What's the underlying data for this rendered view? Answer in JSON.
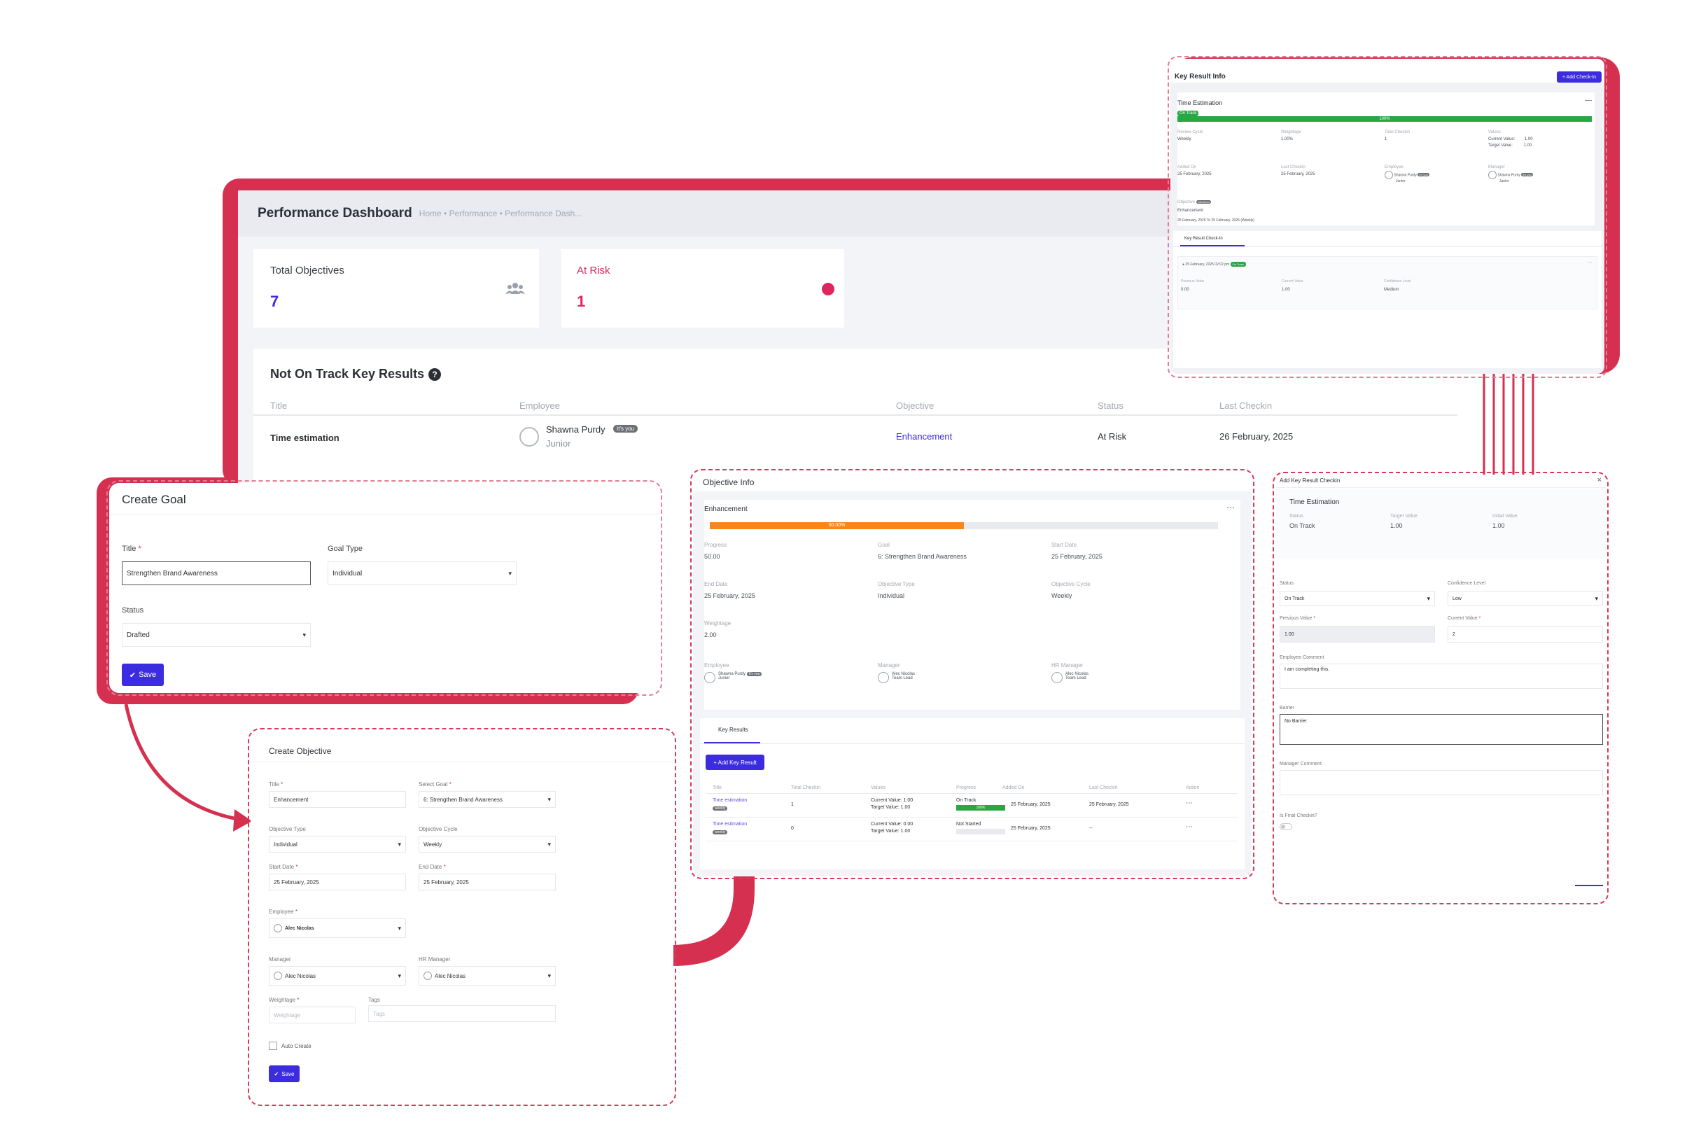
{
  "dashboard": {
    "title": "Performance Dashboard",
    "breadcrumb": "Home • Performance • Performance Dash...",
    "stats": [
      {
        "label": "Total Objectives",
        "value": "7",
        "icon": "users-icon"
      },
      {
        "label": "At Risk",
        "value": "1",
        "icon": "red-dot-icon"
      }
    ],
    "not_on_track": {
      "heading": "Not On Track Key Results",
      "columns": [
        "Title",
        "Employee",
        "Objective",
        "Status",
        "Last Checkin"
      ],
      "row": {
        "title": "Time estimation",
        "employee": "Shawna Purdy",
        "employee_badge": "It's you",
        "employee_role": "Junior",
        "objective": "Enhancement",
        "status": "At Risk",
        "last_checkin": "26 February, 2025"
      }
    }
  },
  "key_result_info": {
    "title": "Key Result Info",
    "add_checkin": "+ Add Check-In",
    "name": "Time Estimation",
    "badge": "On Track",
    "progress_label": "100%",
    "progress": 1.0,
    "fields": [
      {
        "label": "Review Cycle",
        "value": "Weekly"
      },
      {
        "label": "Weightage",
        "value": "1.00%"
      },
      {
        "label": "Total Checkin",
        "value": "1"
      },
      {
        "label": "Values",
        "value": ""
      }
    ],
    "current_value_label": "Current Value:",
    "current_value": "1.00",
    "target_value_label": "Target Value:",
    "target_value": "1.00",
    "fields2": [
      {
        "label": "Added On",
        "value": "25 February, 2025"
      },
      {
        "label": "Last Checkin",
        "value": "25 February, 2025"
      },
      {
        "label": "Employee",
        "value": "Shawna Purdy",
        "badge": "It's you",
        "role": "Junior"
      },
      {
        "label": "Manager",
        "value": "Shawna Purdy",
        "badge": "It's you",
        "role": "Junior"
      }
    ],
    "objective_label": "Objective",
    "objective_badge": "Individual",
    "objective_value": "Enhancement",
    "objective_dates": "25 February, 2025 To 25 February, 2025 (Weekly)",
    "tab": "Key Result Check-In",
    "checkin_time": "25 February, 2025 02:02 pm",
    "checkin_badge": "On Track",
    "checkin_fields": [
      {
        "label": "Previous Value",
        "value": "0.00"
      },
      {
        "label": "Current Value",
        "value": "1.00"
      },
      {
        "label": "Confidence Level",
        "value": "Medium"
      }
    ]
  },
  "create_goal": {
    "title": "Create Goal",
    "title_label": "Title",
    "title_value": "Strengthen Brand Awareness",
    "goal_type_label": "Goal Type",
    "goal_type_value": "Individual",
    "status_label": "Status",
    "status_value": "Drafted",
    "save": "Save"
  },
  "create_objective": {
    "title": "Create Objective",
    "fields": {
      "title_label": "Title",
      "title_value": "Enhancement",
      "goal_label": "Select Goal",
      "goal_value": "6: Strengthen Brand Awareness",
      "type_label": "Objective Type",
      "type_value": "Individual",
      "cycle_label": "Objective Cycle",
      "cycle_value": "Weekly",
      "start_label": "Start Date",
      "start_value": "25 February, 2025",
      "end_label": "End Date",
      "end_value": "25 February, 2025",
      "employee_label": "Employee",
      "employee_value": "Alec Nicolas",
      "manager_label": "Manager",
      "manager_value": "Alec Nicolas",
      "hr_label": "HR Manager",
      "hr_value": "Alec Nicolas",
      "weightage_label": "Weightage",
      "weightage_placeholder": "Weightage",
      "tags_label": "Tags",
      "tags_placeholder": "Tags",
      "auto_create": "Auto Create"
    },
    "save": "Save"
  },
  "objective_info": {
    "title": "Objective Info",
    "name": "Enhancement",
    "progress_label": "50.00%",
    "progress": 0.5,
    "fields": [
      {
        "label": "Progress",
        "value": "50.00"
      },
      {
        "label": "Goal",
        "value": "6: Strengthen Brand Awareness"
      },
      {
        "label": "Start Date",
        "value": "25 February, 2025"
      },
      {
        "label": "End Date",
        "value": "25 February, 2025"
      },
      {
        "label": "Objective Type",
        "value": "Individual"
      },
      {
        "label": "Objective Cycle",
        "value": "Weekly"
      },
      {
        "label": "Weightage",
        "value": "2.00"
      }
    ],
    "people": [
      {
        "label": "Employee",
        "name": "Shawna Purdy",
        "badge": "It's you",
        "role": "Junior"
      },
      {
        "label": "Manager",
        "name": "Alec Nicolas",
        "role": "Team Lead"
      },
      {
        "label": "HR Manager",
        "name": "Alec Nicolas",
        "role": "Team Lead"
      }
    ],
    "tab": "Key Results",
    "add_key_result": "+ Add Key Result",
    "columns": [
      "Title",
      "Total Checkin",
      "Values",
      "Progress",
      "Added On",
      "Last Checkin",
      "Action"
    ],
    "rows": [
      {
        "title": "Time estimation",
        "badge": "weekly",
        "checkin": "1",
        "current": "Current Value: 1.00",
        "target": "Target Value: 1.00",
        "status": "On Track",
        "bar_label": "100%",
        "bar": 1.0,
        "added": "25 February, 2025",
        "last": "25 February, 2025"
      },
      {
        "title": "Time estimation",
        "badge": "weekly",
        "checkin": "0",
        "current": "Current Value: 0.00",
        "target": "Target Value: 1.00",
        "status": "Not Started",
        "bar_label": "",
        "bar": 0.0,
        "added": "25 February, 2025",
        "last": "--"
      }
    ]
  },
  "add_checkin": {
    "title": "Add Key Result Checkin",
    "name": "Time Estimation",
    "status_label": "Status",
    "status_value": "On Track",
    "target_label": "Target Value",
    "target_value": "1.00",
    "initial_label": "Initial Value",
    "initial_value": "1.00",
    "form_status_label": "Status",
    "form_status_value": "On Track",
    "confidence_label": "Confidence Level",
    "confidence_value": "Low",
    "prev_label": "Previous Value",
    "prev_value": "1.00",
    "curr_label": "Current Value",
    "curr_value": "2",
    "emp_comment_label": "Employee Comment",
    "emp_comment_value": "I am completing this.",
    "barrier_label": "Barrier",
    "barrier_value": "No Barrier",
    "mgr_comment_label": "Manager Comment",
    "final_label": "Is Final Checkin?"
  },
  "colors": {
    "accent": "#d5304f",
    "primary": "#3b2ce0",
    "green": "#28a745",
    "orange": "#f7871a"
  }
}
